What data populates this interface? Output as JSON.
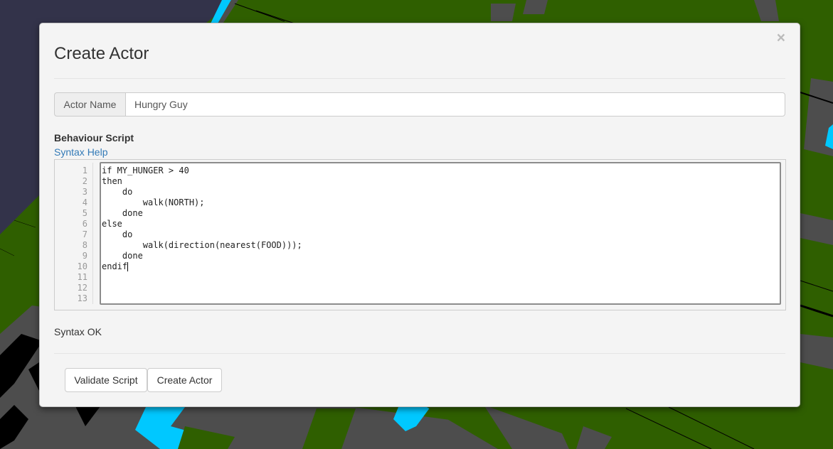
{
  "background": {
    "description": "3D voxel world scene",
    "colors": {
      "sky": "#33334a",
      "grass": "#2f5f00",
      "stone": "#4d4d4d",
      "water": "#00c8ff",
      "shadow": "#000000"
    }
  },
  "modal": {
    "title": "Create Actor",
    "close_label": "×",
    "actor_name": {
      "label": "Actor Name",
      "value": "Hungry Guy"
    },
    "script_section": {
      "label": "Behaviour Script",
      "help_link": "Syntax Help"
    },
    "editor": {
      "line_numbers": [
        "1",
        "2",
        "3",
        "4",
        "5",
        "6",
        "7",
        "8",
        "9",
        "10",
        "11",
        "12",
        "13"
      ],
      "lines": [
        "if MY_HUNGER > 40",
        "then",
        "    do",
        "        walk(NORTH);",
        "    done",
        "else",
        "    do",
        "        walk(direction(nearest(FOOD)));",
        "    done",
        "endif",
        "",
        "",
        ""
      ]
    },
    "status": "Syntax OK",
    "buttons": {
      "validate": "Validate Script",
      "create": "Create Actor"
    }
  }
}
